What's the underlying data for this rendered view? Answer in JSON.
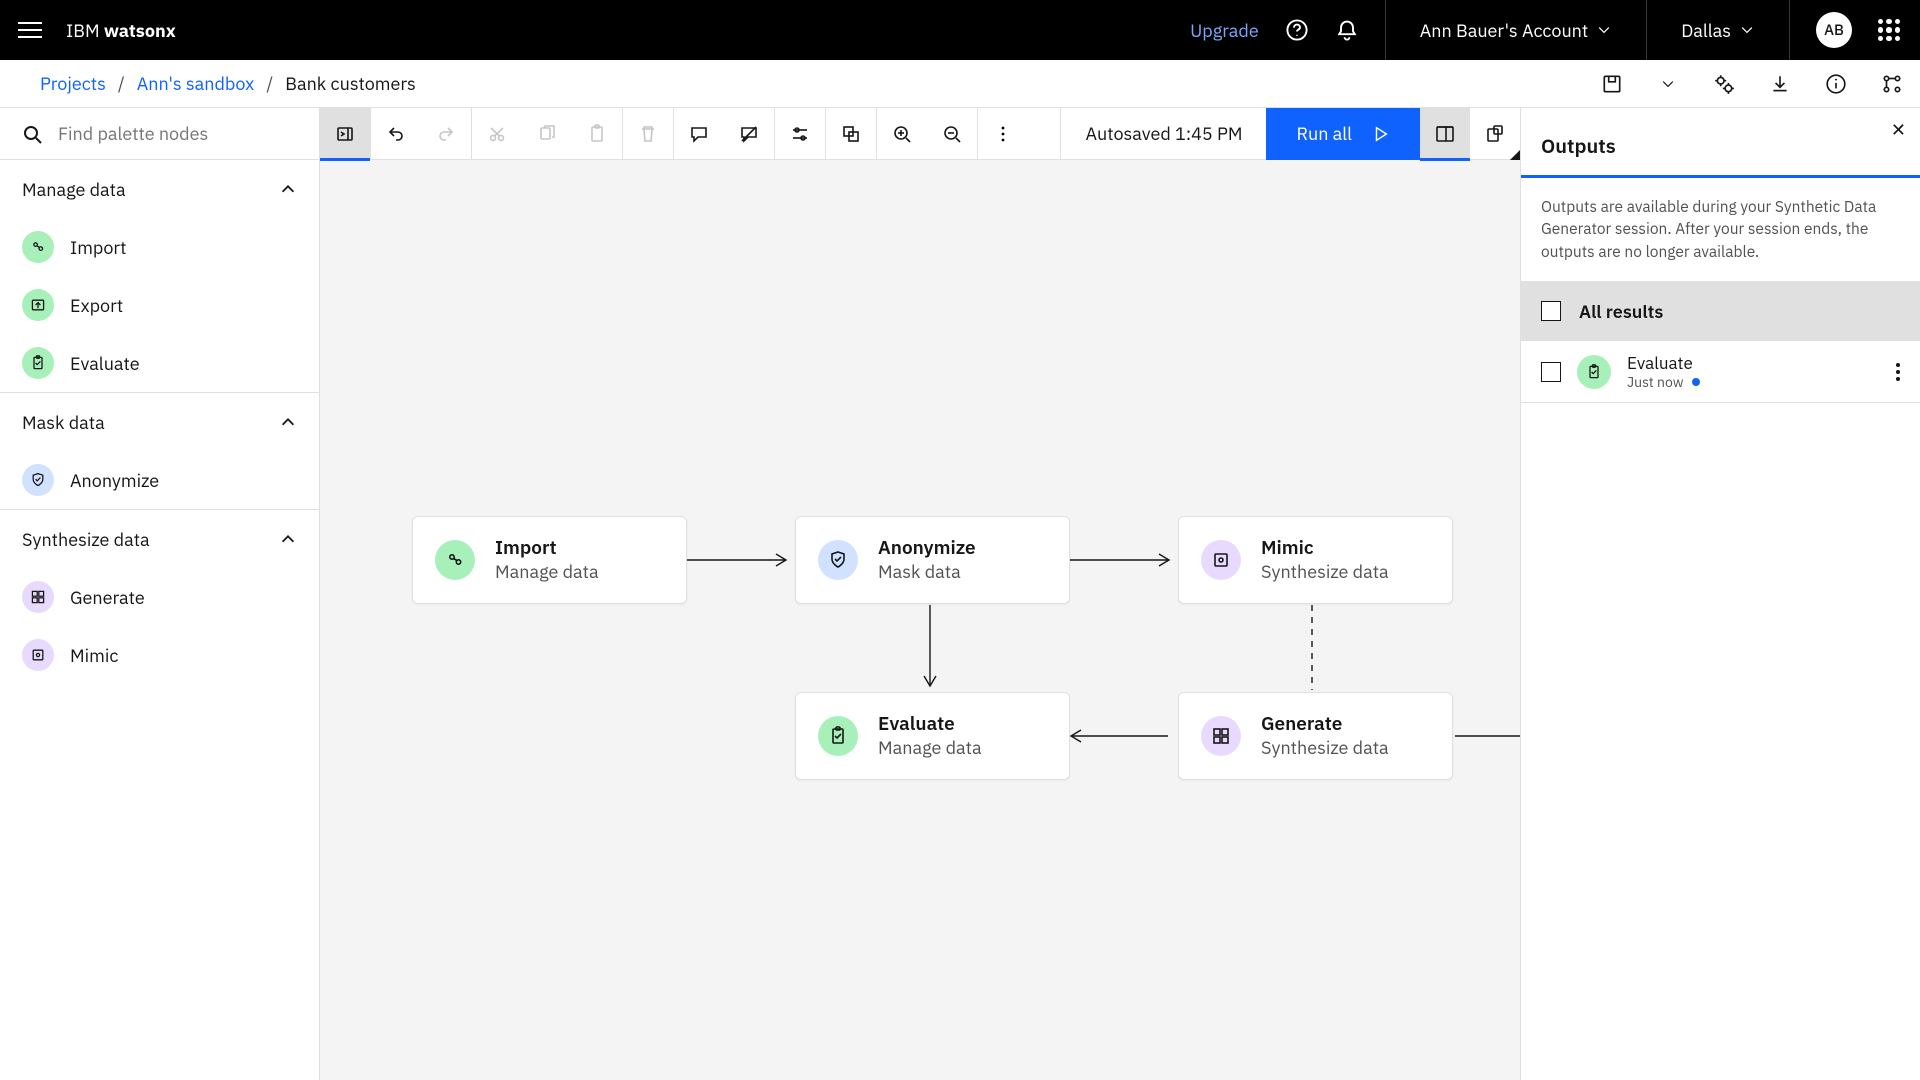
{
  "topbar": {
    "brand_prefix": "IBM ",
    "brand_bold": "watsonx",
    "upgrade": "Upgrade",
    "account": "Ann Bauer's Account",
    "region": "Dallas",
    "avatar": "AB"
  },
  "breadcrumbs": {
    "root": "Projects",
    "parent": "Ann's sandbox",
    "current": "Bank customers"
  },
  "toolbar": {
    "autosave": "Autosaved 1:45 PM",
    "run_all": "Run all"
  },
  "palette": {
    "search_placeholder": "Find palette nodes",
    "sections": [
      {
        "title": "Manage data",
        "items": [
          {
            "label": "Import",
            "chip": "green"
          },
          {
            "label": "Export",
            "chip": "green"
          },
          {
            "label": "Evaluate",
            "chip": "green"
          }
        ]
      },
      {
        "title": "Mask data",
        "items": [
          {
            "label": "Anonymize",
            "chip": "blue"
          }
        ]
      },
      {
        "title": "Synthesize data",
        "items": [
          {
            "label": "Generate",
            "chip": "purple"
          },
          {
            "label": "Mimic",
            "chip": "purple"
          }
        ]
      }
    ]
  },
  "canvas": {
    "nodes": {
      "import": {
        "title": "Import",
        "sub": "Manage data",
        "chip": "green"
      },
      "anonymize": {
        "title": "Anonymize",
        "sub": "Mask data",
        "chip": "blue"
      },
      "mimic": {
        "title": "Mimic",
        "sub": "Synthesize data",
        "chip": "purple"
      },
      "evaluate": {
        "title": "Evaluate",
        "sub": "Manage data",
        "chip": "green"
      },
      "generate": {
        "title": "Generate",
        "sub": "Synthesize data",
        "chip": "purple"
      }
    }
  },
  "outputs": {
    "heading": "Outputs",
    "description": "Outputs are available during your Synthetic Data Generator session. After your session ends, the outputs are no longer available.",
    "all_results": "All results",
    "items": [
      {
        "title": "Evaluate",
        "time": "Just now",
        "chip": "green"
      }
    ]
  }
}
